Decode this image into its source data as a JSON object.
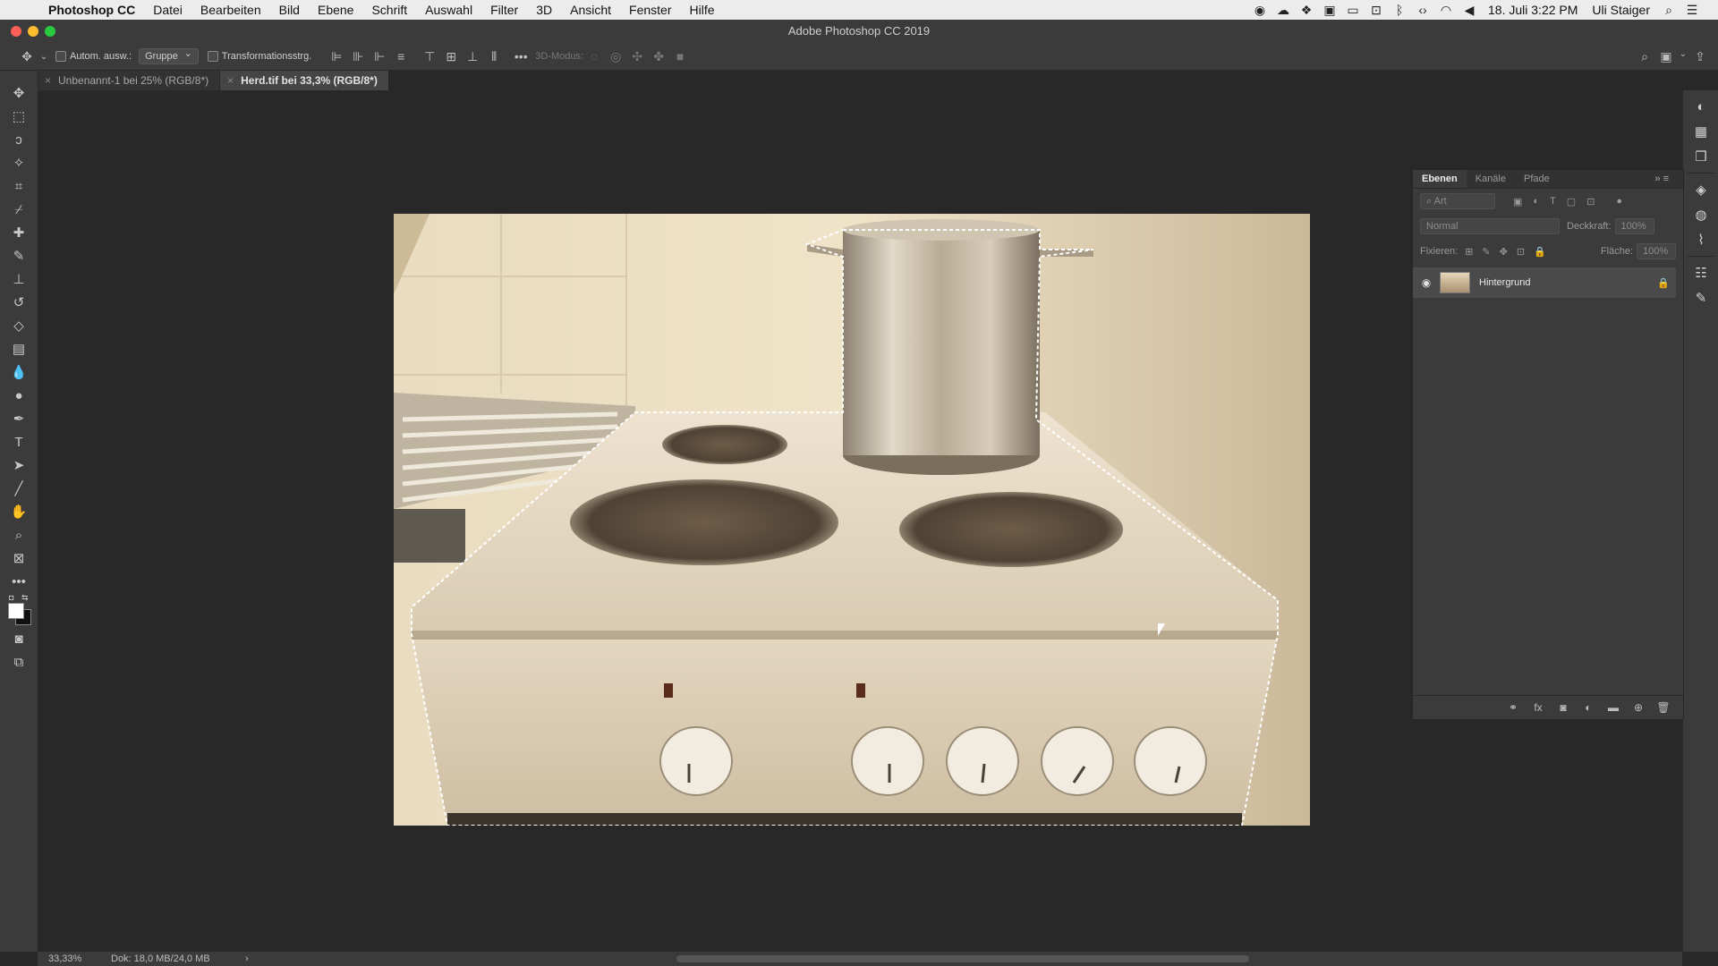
{
  "menubar": {
    "apple_glyph": "",
    "items": [
      "Photoshop CC",
      "Datei",
      "Bearbeiten",
      "Bild",
      "Ebene",
      "Schrift",
      "Auswahl",
      "Filter",
      "3D",
      "Ansicht",
      "Fenster",
      "Hilfe"
    ],
    "status": {
      "date_time": "18. Juli  3:22 PM",
      "user": "Uli Staiger"
    }
  },
  "window": {
    "title": "Adobe Photoshop CC 2019"
  },
  "options": {
    "auto_select_label": "Autom. ausw.:",
    "auto_select_value": "Gruppe",
    "transform_label": "Transformationsstrg.",
    "mode_3d_label": "3D-Modus:"
  },
  "tabs": [
    {
      "label": "Unbenannt-1 bei 25% (RGB/8*)",
      "active": false
    },
    {
      "label": "Herd.tif bei 33,3% (RGB/8*)",
      "active": true
    }
  ],
  "layers_panel": {
    "tabs": [
      "Ebenen",
      "Kanäle",
      "Pfade"
    ],
    "filter_placeholder": "Art",
    "blend_mode": "Normal",
    "opacity_label": "Deckkraft:",
    "opacity_value": "100%",
    "lock_label": "Fixieren:",
    "fill_label": "Fläche:",
    "fill_value": "100%",
    "layers": [
      {
        "name": "Hintergrund",
        "visible": true,
        "locked": true
      }
    ]
  },
  "status": {
    "zoom": "33,33%",
    "doc": "Dok: 18,0 MB/24,0 MB",
    "arrow": "›"
  },
  "colors": {
    "ui_panel": "#3b3b3b",
    "canvas_bg": "#282828",
    "menubar": "#ececec",
    "close": "#fc5f57",
    "minimize": "#fdbc2e",
    "zoom_btn": "#28c840"
  }
}
